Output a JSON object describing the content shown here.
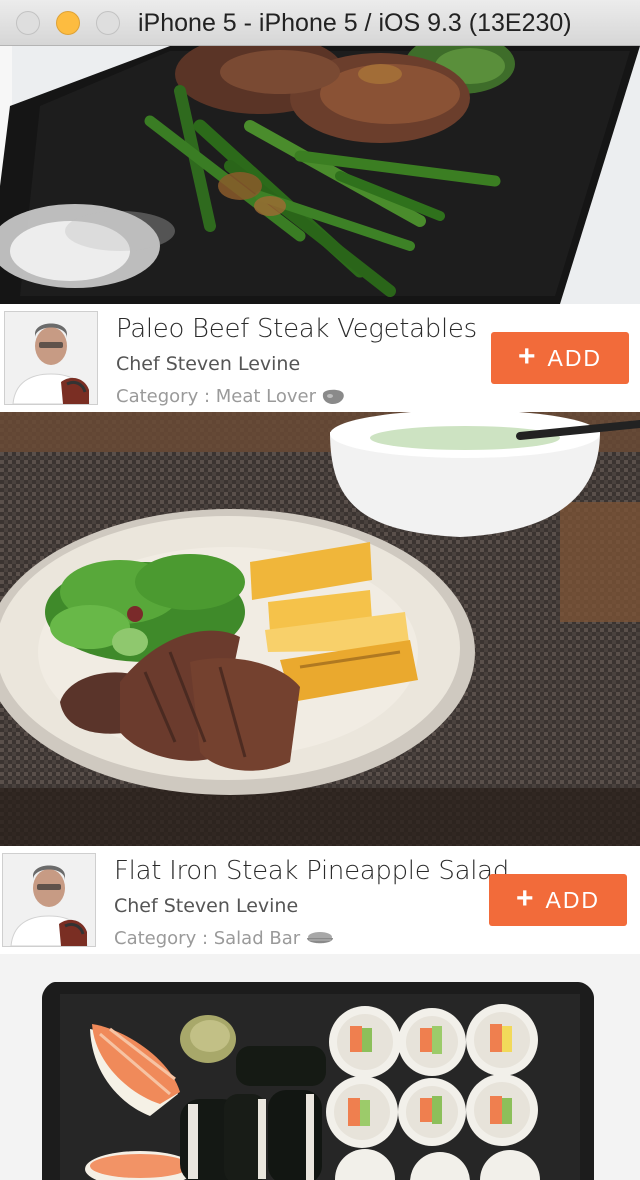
{
  "window": {
    "title": "iPhone 5 - iPhone 5 / iOS 9.3 (13E230)"
  },
  "recipes": [
    {
      "title": "Paleo Beef Steak Vegetables",
      "chef": "Chef Steven Levine",
      "category_label": "Category : Meat Lover",
      "category_icon": "steak-icon",
      "add_label": "ADD",
      "add_icon": "plus-icon"
    },
    {
      "title": "Flat Iron Steak Pineapple Salad",
      "chef": "Chef Steven Levine",
      "category_label": "Category : Salad Bar",
      "category_icon": "salad-bowl-icon",
      "add_label": "ADD",
      "add_icon": "plus-icon"
    }
  ],
  "colors": {
    "accent": "#f26b3a",
    "minimize_button": "#fdbc40"
  }
}
